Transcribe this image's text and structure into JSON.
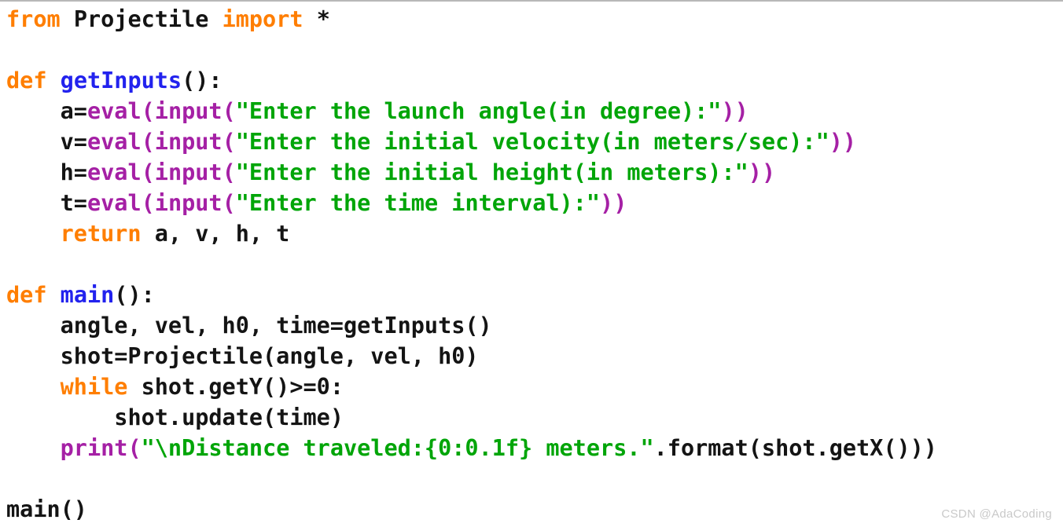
{
  "editor": {
    "language": "python",
    "background_color": "#ffffff",
    "top_rule_color": "#b8b8b8",
    "syntax_colors": {
      "keyword": "#ff7e00",
      "function_name": "#2222ee",
      "builtin": "#a520a5",
      "string": "#00a508",
      "plain": "#141414"
    }
  },
  "code": {
    "lines": [
      {
        "id": "line-1",
        "indent": 0,
        "tokens": [
          {
            "text": "from",
            "kind": "kw"
          },
          {
            "text": " ",
            "kind": "plain"
          },
          {
            "text": "Projectile",
            "kind": "plain"
          },
          {
            "text": " ",
            "kind": "plain"
          },
          {
            "text": "import",
            "kind": "kw"
          },
          {
            "text": " *",
            "kind": "plain"
          }
        ]
      },
      {
        "id": "line-2",
        "indent": 0,
        "tokens": []
      },
      {
        "id": "line-3",
        "indent": 0,
        "tokens": [
          {
            "text": "def",
            "kind": "kw"
          },
          {
            "text": " ",
            "kind": "plain"
          },
          {
            "text": "getInputs",
            "kind": "fn"
          },
          {
            "text": "():",
            "kind": "plain"
          }
        ]
      },
      {
        "id": "line-4",
        "indent": 4,
        "tokens": [
          {
            "text": "a=",
            "kind": "plain"
          },
          {
            "text": "eval",
            "kind": "builtin"
          },
          {
            "text": "(",
            "kind": "builtin"
          },
          {
            "text": "input",
            "kind": "builtin"
          },
          {
            "text": "(",
            "kind": "builtin"
          },
          {
            "text": "\"Enter the launch angle(in degree):\"",
            "kind": "str"
          },
          {
            "text": "))",
            "kind": "builtin"
          }
        ]
      },
      {
        "id": "line-5",
        "indent": 4,
        "tokens": [
          {
            "text": "v=",
            "kind": "plain"
          },
          {
            "text": "eval",
            "kind": "builtin"
          },
          {
            "text": "(",
            "kind": "builtin"
          },
          {
            "text": "input",
            "kind": "builtin"
          },
          {
            "text": "(",
            "kind": "builtin"
          },
          {
            "text": "\"Enter the initial velocity(in meters/sec):\"",
            "kind": "str"
          },
          {
            "text": "))",
            "kind": "builtin"
          }
        ]
      },
      {
        "id": "line-6",
        "indent": 4,
        "tokens": [
          {
            "text": "h=",
            "kind": "plain"
          },
          {
            "text": "eval",
            "kind": "builtin"
          },
          {
            "text": "(",
            "kind": "builtin"
          },
          {
            "text": "input",
            "kind": "builtin"
          },
          {
            "text": "(",
            "kind": "builtin"
          },
          {
            "text": "\"Enter the initial height(in meters):\"",
            "kind": "str"
          },
          {
            "text": "))",
            "kind": "builtin"
          }
        ]
      },
      {
        "id": "line-7",
        "indent": 4,
        "tokens": [
          {
            "text": "t=",
            "kind": "plain"
          },
          {
            "text": "eval",
            "kind": "builtin"
          },
          {
            "text": "(",
            "kind": "builtin"
          },
          {
            "text": "input",
            "kind": "builtin"
          },
          {
            "text": "(",
            "kind": "builtin"
          },
          {
            "text": "\"Enter the time interval):\"",
            "kind": "str"
          },
          {
            "text": "))",
            "kind": "builtin"
          }
        ]
      },
      {
        "id": "line-8",
        "indent": 4,
        "tokens": [
          {
            "text": "return",
            "kind": "kw"
          },
          {
            "text": " a, v, h, t",
            "kind": "plain"
          }
        ]
      },
      {
        "id": "line-9",
        "indent": 0,
        "tokens": []
      },
      {
        "id": "line-10",
        "indent": 0,
        "tokens": [
          {
            "text": "def",
            "kind": "kw"
          },
          {
            "text": " ",
            "kind": "plain"
          },
          {
            "text": "main",
            "kind": "fn"
          },
          {
            "text": "():",
            "kind": "plain"
          }
        ]
      },
      {
        "id": "line-11",
        "indent": 4,
        "tokens": [
          {
            "text": "angle, vel, h0, time=getInputs()",
            "kind": "plain"
          }
        ]
      },
      {
        "id": "line-12",
        "indent": 4,
        "tokens": [
          {
            "text": "shot=Projectile(angle, vel, h0)",
            "kind": "plain"
          }
        ]
      },
      {
        "id": "line-13",
        "indent": 4,
        "tokens": [
          {
            "text": "while",
            "kind": "kw"
          },
          {
            "text": " shot.getY()>=0:",
            "kind": "plain"
          }
        ]
      },
      {
        "id": "line-14",
        "indent": 8,
        "tokens": [
          {
            "text": "shot.update(time)",
            "kind": "plain"
          }
        ]
      },
      {
        "id": "line-15",
        "indent": 4,
        "tokens": [
          {
            "text": "print",
            "kind": "builtin"
          },
          {
            "text": "(",
            "kind": "builtin"
          },
          {
            "text": "\"\\nDistance traveled:{0:0.1f} meters.\"",
            "kind": "str"
          },
          {
            "text": ".format(shot.getX()))",
            "kind": "plain"
          }
        ]
      },
      {
        "id": "line-16",
        "indent": 0,
        "tokens": []
      },
      {
        "id": "line-17",
        "indent": 0,
        "tokens": [
          {
            "text": "main()",
            "kind": "plain"
          }
        ]
      }
    ]
  },
  "watermark": {
    "text": "CSDN @AdaCoding",
    "color": "#c9c9c9"
  }
}
